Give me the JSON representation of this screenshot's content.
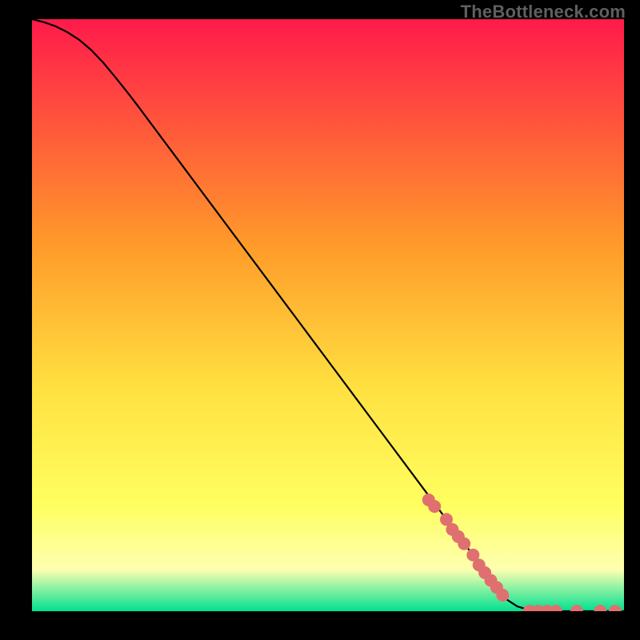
{
  "watermark": "TheBottleneck.com",
  "colors": {
    "frame": "#000000",
    "curve": "#000000",
    "marker": "#e07070",
    "gradient_top": "#ff1a4b",
    "gradient_mid1": "#ff9a2a",
    "gradient_mid2": "#ffe040",
    "gradient_mid3": "#ffff60",
    "gradient_mid4": "#fdffb0",
    "gradient_bot": "#00e090"
  },
  "chart_data": {
    "type": "line",
    "title": "",
    "xlabel": "",
    "ylabel": "",
    "xlim": [
      0,
      100
    ],
    "ylim": [
      0,
      100
    ],
    "curve": {
      "x": [
        0,
        2,
        4,
        6,
        8,
        10,
        12,
        14,
        16,
        18,
        20,
        25,
        30,
        35,
        40,
        45,
        50,
        55,
        60,
        65,
        70,
        75,
        80,
        82,
        84,
        86,
        88,
        90,
        92,
        94,
        96,
        98,
        100
      ],
      "y": [
        100,
        99.5,
        98.8,
        97.8,
        96.5,
        94.8,
        92.7,
        90.3,
        87.8,
        85.2,
        82.5,
        75.8,
        69.1,
        62.4,
        55.7,
        49,
        42.3,
        35.6,
        28.9,
        22.2,
        15.5,
        8.8,
        2.1,
        0.8,
        0.2,
        0,
        0,
        0,
        0,
        0,
        0,
        0,
        0
      ]
    },
    "markers": [
      {
        "x": 67,
        "y": 18.8
      },
      {
        "x": 68,
        "y": 17.7
      },
      {
        "x": 70,
        "y": 15.5
      },
      {
        "x": 71,
        "y": 13.8
      },
      {
        "x": 72,
        "y": 12.6
      },
      {
        "x": 73,
        "y": 11.4
      },
      {
        "x": 74.5,
        "y": 9.5
      },
      {
        "x": 75.5,
        "y": 7.8
      },
      {
        "x": 76.5,
        "y": 6.5
      },
      {
        "x": 77.5,
        "y": 5.2
      },
      {
        "x": 78.5,
        "y": 4
      },
      {
        "x": 79.5,
        "y": 2.7
      },
      {
        "x": 84,
        "y": 0
      },
      {
        "x": 85.5,
        "y": 0
      },
      {
        "x": 87,
        "y": 0
      },
      {
        "x": 88.5,
        "y": 0
      },
      {
        "x": 92,
        "y": 0
      },
      {
        "x": 96,
        "y": 0
      },
      {
        "x": 98.5,
        "y": 0
      }
    ]
  }
}
